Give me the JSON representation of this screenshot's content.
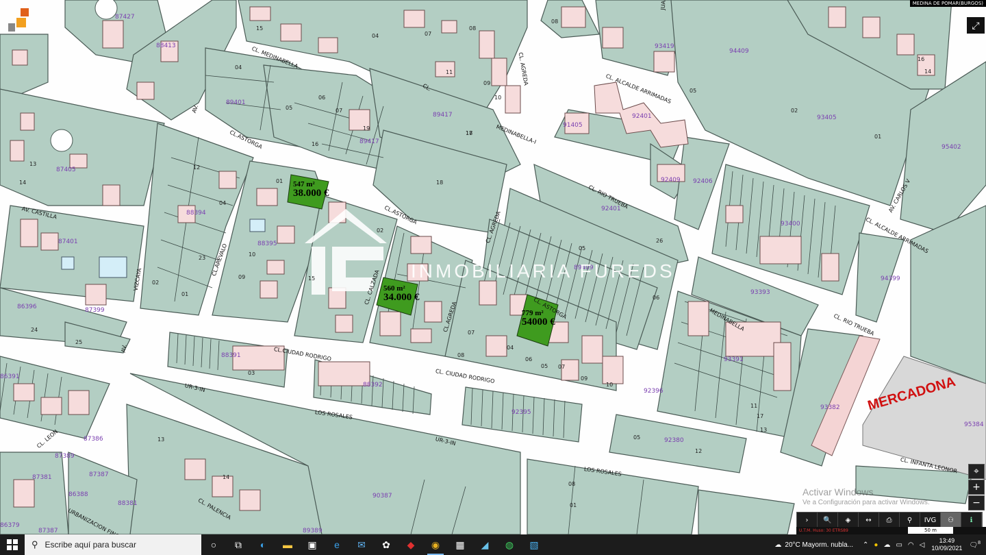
{
  "header": {
    "scale_title": "MEDINA DE POMAR(BURGOS)"
  },
  "streets": [
    {
      "id": "medinabella1",
      "text": "CL.     MEDINABELLA"
    },
    {
      "id": "agreda1",
      "text": "CL. AGREDA"
    },
    {
      "id": "juan",
      "text": "JUAN"
    },
    {
      "id": "alcalde1",
      "text": "CL. ALCALDE ARRIMADAS"
    },
    {
      "id": "cl_small",
      "text": "CL."
    },
    {
      "id": "medinabella2",
      "text": "MEDINABELLA-I"
    },
    {
      "id": "astorga1",
      "text": "CL.ASTORGA"
    },
    {
      "id": "astorga2",
      "text": "CL.ASTORGA"
    },
    {
      "id": "astorga3",
      "text": "CL. ASTORGA"
    },
    {
      "id": "riotrueba1",
      "text": "CL. RIO TRUEBA"
    },
    {
      "id": "riotrueba2",
      "text": "CL. RIO TRUEBA"
    },
    {
      "id": "carlos",
      "text": "AV. CARLOS V"
    },
    {
      "id": "alcalde2",
      "text": "CL. ALCALDE ARRIMADAS"
    },
    {
      "id": "castilla",
      "text": "AV. CASTILLA"
    },
    {
      "id": "arevalo",
      "text": "CL.AREVALO"
    },
    {
      "id": "vizcaya",
      "text": "VIZCAYA"
    },
    {
      "id": "av1",
      "text": "AV."
    },
    {
      "id": "av2",
      "text": "AV."
    },
    {
      "id": "agreda2",
      "text": "CL. AGREDA"
    },
    {
      "id": "agreda3",
      "text": "CL.AGREDA"
    },
    {
      "id": "calzada",
      "text": "CL. CALZADA"
    },
    {
      "id": "ciudadrodrigo1",
      "text": "CL.CIUDAD RODRIGO"
    },
    {
      "id": "ciudadrodrigo2",
      "text": "CL. CIUDAD RODRIGO"
    },
    {
      "id": "ur1",
      "text": "UR-3-IN"
    },
    {
      "id": "ur2",
      "text": "UR-3-IN"
    },
    {
      "id": "rosales1",
      "text": "LOS ROSALES"
    },
    {
      "id": "rosales2",
      "text": "LOS ROSALES"
    },
    {
      "id": "leon",
      "text": "CL. LEON"
    },
    {
      "id": "urb",
      "text": "URBANIZACION FINCA"
    },
    {
      "id": "palencia",
      "text": "CL. PALENCIA"
    },
    {
      "id": "infanta",
      "text": "CL. INFANTA LEONOR"
    },
    {
      "id": "medinabella3",
      "text": "MEDINABELLA"
    }
  ],
  "parcels": [
    "87427",
    "88413",
    "89401",
    "87405",
    "89417",
    "89417",
    "91405",
    "92401",
    "94409",
    "93419",
    "93405",
    "95402",
    "92409",
    "92406",
    "92401",
    "93400",
    "94399",
    "88394",
    "87401",
    "86396",
    "87399",
    "88395",
    "89409",
    "93393",
    "88391",
    "93391",
    "88392",
    "92396",
    "92395",
    "93382",
    "92380",
    "95384",
    "86391",
    "87386",
    "87389",
    "87387",
    "87381",
    "86388",
    "88381",
    "90387",
    "87387",
    "86379",
    "89389"
  ],
  "lots": [
    "15",
    "08",
    "07",
    "04",
    "04",
    "05",
    "06",
    "07",
    "08",
    "10",
    "11",
    "09",
    "02",
    "05",
    "01",
    "12",
    "13",
    "14",
    "16",
    "17",
    "18",
    "10",
    "09",
    "01",
    "02",
    "04",
    "05",
    "06",
    "07",
    "08",
    "26",
    "25",
    "24",
    "23",
    "01",
    "02",
    "03",
    "05",
    "12",
    "13",
    "14",
    "08",
    "01",
    "04",
    "05",
    "06",
    "07",
    "09",
    "10",
    "11",
    "17",
    "13",
    "15",
    "19",
    "18",
    "16",
    "14"
  ],
  "listings": [
    {
      "area": "547 m²",
      "price": "38.000 €"
    },
    {
      "area": "560 m²",
      "price": "34.000 €"
    },
    {
      "area": "779 m²",
      "price": "54000 €"
    }
  ],
  "watermark": {
    "text": "INMOBILIARIA  FUREDS"
  },
  "landmark": {
    "text": "MERCADONA"
  },
  "controls": {
    "zoom_in": "+",
    "zoom_out": "−",
    "locate": "⌖",
    "expand": "⤢"
  },
  "toolbar": {
    "buttons": [
      "›",
      "🔍",
      "◈",
      "↔",
      "⎙",
      "⚲",
      "IVG",
      "⚇",
      "ℹ"
    ]
  },
  "coords": "U.T.M. Huso: 30  ETRS89",
  "scale_text": "50 m",
  "activate": {
    "title": "Activar Windows",
    "subtitle": "Ve a Configuración para activar Windows."
  },
  "taskbar": {
    "search_placeholder": "Escribe aquí para buscar",
    "weather": "20°C  Mayorm. nubla...",
    "time": "13:49",
    "date": "10/09/2021",
    "notifications": "8"
  }
}
